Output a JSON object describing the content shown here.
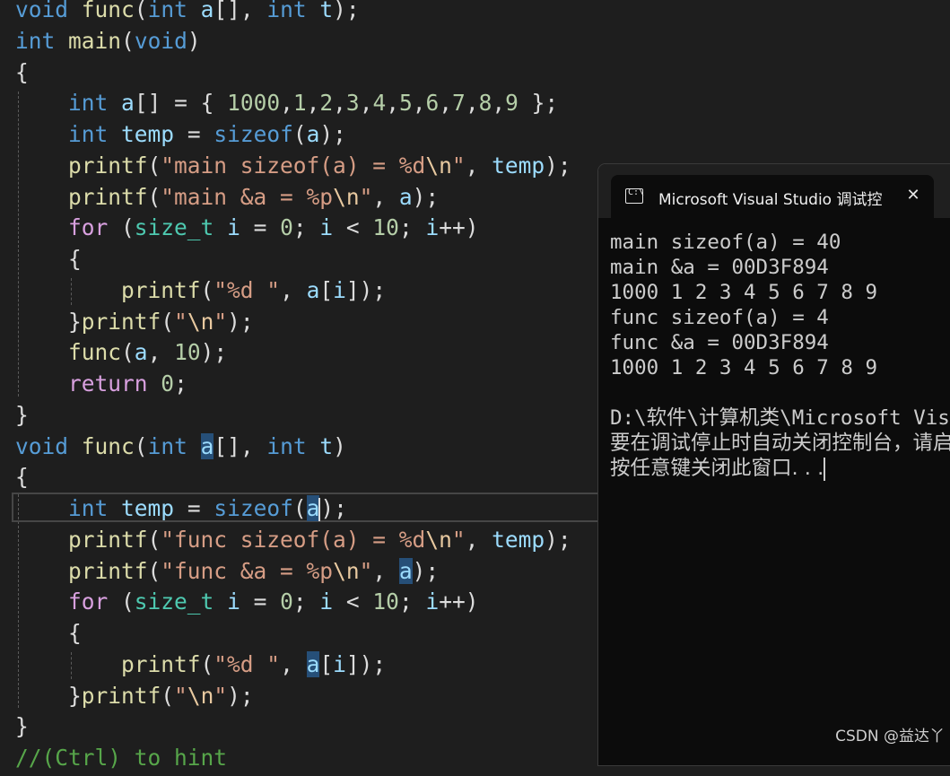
{
  "editor": {
    "lines": [
      "void func(int a[], int t);",
      "int main(void)",
      "{",
      "    int a[] = { 1000,1,2,3,4,5,6,7,8,9 };",
      "    int temp = sizeof(a);",
      "    printf(\"main sizeof(a) = %d\\n\", temp);",
      "    printf(\"main &a = %p\\n\", a);",
      "    for (size_t i = 0; i < 10; i++)",
      "    {",
      "        printf(\"%d \", a[i]);",
      "    }printf(\"\\n\");",
      "    func(a, 10);",
      "    return 0;",
      "}",
      "void func(int a[], int t)",
      "{",
      "    int temp = sizeof(a);",
      "    printf(\"func sizeof(a) = %d\\n\", temp);",
      "    printf(\"func &a = %p\\n\", a);",
      "    for (size_t i = 0; i < 10; i++)",
      "    {",
      "        printf(\"%d \", a[i]);",
      "    }printf(\"\\n\");",
      "}",
      "//(Ctrl) to hint"
    ]
  },
  "console": {
    "tab_title": "Microsoft Visual Studio 调试控制台",
    "icon_label": "C:\\",
    "close_glyph": "✕",
    "output": [
      "main sizeof(a) = 40",
      "main &a = 00D3F894",
      "1000 1 2 3 4 5 6 7 8 9",
      "func sizeof(a) = 4",
      "func &a = 00D3F894",
      "1000 1 2 3 4 5 6 7 8 9",
      "",
      "D:\\软件\\计算机类\\Microsoft Visual Studio",
      "要在调试停止时自动关闭控制台，请启用",
      "按任意键关闭此窗口. . ."
    ]
  },
  "watermark": "CSDN @益达丫",
  "colors": {
    "editor_bg": "#1e1e1e",
    "keyword": "#569cd6",
    "control": "#d8a0df",
    "function": "#dcdcaa",
    "variable": "#9cdcfe",
    "number": "#b5cea8",
    "string": "#d69d85",
    "type": "#4ec9b0",
    "highlight": "#264f78",
    "console_bg": "#0c0c0c"
  }
}
